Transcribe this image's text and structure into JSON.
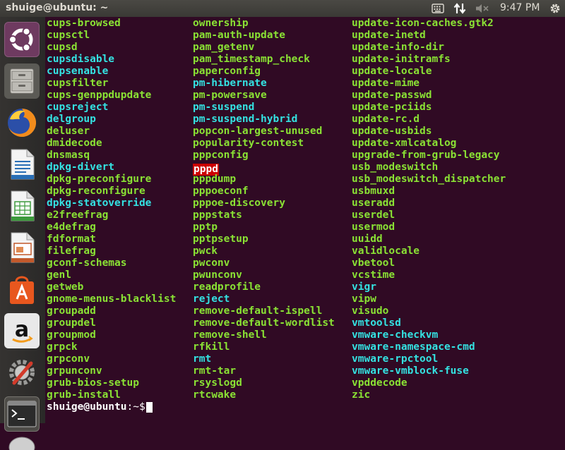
{
  "window": {
    "title": "shuige@ubuntu: ~"
  },
  "panel": {
    "clock": "9:47 PM",
    "icons": [
      "keyboard-icon",
      "network-transfer-icon",
      "volume-muted-icon",
      "power-gear-icon"
    ]
  },
  "launcher": {
    "items": [
      {
        "name": "ubuntu-dash-icon"
      },
      {
        "name": "files-icon"
      },
      {
        "name": "firefox-icon"
      },
      {
        "name": "libreoffice-writer-icon"
      },
      {
        "name": "libreoffice-calc-icon"
      },
      {
        "name": "libreoffice-impress-icon"
      },
      {
        "name": "ubuntu-software-icon"
      },
      {
        "name": "amazon-icon"
      },
      {
        "name": "system-settings-icon"
      },
      {
        "name": "terminal-icon"
      },
      {
        "name": "dvd-icon"
      }
    ]
  },
  "terminal": {
    "columns": [
      [
        {
          "t": "cups-browsed",
          "k": "exec"
        },
        {
          "t": "cupsctl",
          "k": "exec"
        },
        {
          "t": "cupsd",
          "k": "exec"
        },
        {
          "t": "cupsdisable",
          "k": "link"
        },
        {
          "t": "cupsenable",
          "k": "link"
        },
        {
          "t": "cupsfilter",
          "k": "exec"
        },
        {
          "t": "cups-genppdupdate",
          "k": "exec"
        },
        {
          "t": "cupsreject",
          "k": "link"
        },
        {
          "t": "delgroup",
          "k": "link"
        },
        {
          "t": "deluser",
          "k": "exec"
        },
        {
          "t": "dmidecode",
          "k": "exec"
        },
        {
          "t": "dnsmasq",
          "k": "exec"
        },
        {
          "t": "dpkg-divert",
          "k": "link"
        },
        {
          "t": "dpkg-preconfigure",
          "k": "exec"
        },
        {
          "t": "dpkg-reconfigure",
          "k": "exec"
        },
        {
          "t": "dpkg-statoverride",
          "k": "link"
        },
        {
          "t": "e2freefrag",
          "k": "exec"
        },
        {
          "t": "e4defrag",
          "k": "exec"
        },
        {
          "t": "fdformat",
          "k": "exec"
        },
        {
          "t": "filefrag",
          "k": "exec"
        },
        {
          "t": "gconf-schemas",
          "k": "exec"
        },
        {
          "t": "genl",
          "k": "exec"
        },
        {
          "t": "getweb",
          "k": "exec"
        },
        {
          "t": "gnome-menus-blacklist",
          "k": "exec"
        },
        {
          "t": "groupadd",
          "k": "exec"
        },
        {
          "t": "groupdel",
          "k": "exec"
        },
        {
          "t": "groupmod",
          "k": "exec"
        },
        {
          "t": "grpck",
          "k": "exec"
        },
        {
          "t": "grpconv",
          "k": "exec"
        },
        {
          "t": "grpunconv",
          "k": "exec"
        },
        {
          "t": "grub-bios-setup",
          "k": "exec"
        },
        {
          "t": "grub-install",
          "k": "exec"
        }
      ],
      [
        {
          "t": "ownership",
          "k": "exec"
        },
        {
          "t": "pam-auth-update",
          "k": "exec"
        },
        {
          "t": "pam_getenv",
          "k": "exec"
        },
        {
          "t": "pam_timestamp_check",
          "k": "exec"
        },
        {
          "t": "paperconfig",
          "k": "exec"
        },
        {
          "t": "pm-hibernate",
          "k": "link"
        },
        {
          "t": "pm-powersave",
          "k": "exec"
        },
        {
          "t": "pm-suspend",
          "k": "link"
        },
        {
          "t": "pm-suspend-hybrid",
          "k": "link"
        },
        {
          "t": "popcon-largest-unused",
          "k": "exec"
        },
        {
          "t": "popularity-contest",
          "k": "exec"
        },
        {
          "t": "pppconfig",
          "k": "exec"
        },
        {
          "t": "pppd",
          "k": "hl"
        },
        {
          "t": "pppdump",
          "k": "exec"
        },
        {
          "t": "pppoeconf",
          "k": "exec"
        },
        {
          "t": "pppoe-discovery",
          "k": "exec"
        },
        {
          "t": "pppstats",
          "k": "exec"
        },
        {
          "t": "pptp",
          "k": "exec"
        },
        {
          "t": "pptpsetup",
          "k": "exec"
        },
        {
          "t": "pwck",
          "k": "exec"
        },
        {
          "t": "pwconv",
          "k": "exec"
        },
        {
          "t": "pwunconv",
          "k": "exec"
        },
        {
          "t": "readprofile",
          "k": "exec"
        },
        {
          "t": "reject",
          "k": "link"
        },
        {
          "t": "remove-default-ispell",
          "k": "exec"
        },
        {
          "t": "remove-default-wordlist",
          "k": "exec"
        },
        {
          "t": "remove-shell",
          "k": "exec"
        },
        {
          "t": "rfkill",
          "k": "exec"
        },
        {
          "t": "rmt",
          "k": "link"
        },
        {
          "t": "rmt-tar",
          "k": "exec"
        },
        {
          "t": "rsyslogd",
          "k": "exec"
        },
        {
          "t": "rtcwake",
          "k": "exec"
        }
      ],
      [
        {
          "t": "update-icon-caches.gtk2",
          "k": "exec"
        },
        {
          "t": "update-inetd",
          "k": "exec"
        },
        {
          "t": "update-info-dir",
          "k": "exec"
        },
        {
          "t": "update-initramfs",
          "k": "exec"
        },
        {
          "t": "update-locale",
          "k": "exec"
        },
        {
          "t": "update-mime",
          "k": "exec"
        },
        {
          "t": "update-passwd",
          "k": "exec"
        },
        {
          "t": "update-pciids",
          "k": "exec"
        },
        {
          "t": "update-rc.d",
          "k": "exec"
        },
        {
          "t": "update-usbids",
          "k": "exec"
        },
        {
          "t": "update-xmlcatalog",
          "k": "exec"
        },
        {
          "t": "upgrade-from-grub-legacy",
          "k": "exec"
        },
        {
          "t": "usb_modeswitch",
          "k": "exec"
        },
        {
          "t": "usb_modeswitch_dispatcher",
          "k": "exec"
        },
        {
          "t": "usbmuxd",
          "k": "exec"
        },
        {
          "t": "useradd",
          "k": "exec"
        },
        {
          "t": "userdel",
          "k": "exec"
        },
        {
          "t": "usermod",
          "k": "exec"
        },
        {
          "t": "uuidd",
          "k": "exec"
        },
        {
          "t": "validlocale",
          "k": "exec"
        },
        {
          "t": "vbetool",
          "k": "exec"
        },
        {
          "t": "vcstime",
          "k": "exec"
        },
        {
          "t": "vigr",
          "k": "link"
        },
        {
          "t": "vipw",
          "k": "exec"
        },
        {
          "t": "visudo",
          "k": "exec"
        },
        {
          "t": "vmtoolsd",
          "k": "link"
        },
        {
          "t": "vmware-checkvm",
          "k": "link"
        },
        {
          "t": "vmware-namespace-cmd",
          "k": "link"
        },
        {
          "t": "vmware-rpctool",
          "k": "link"
        },
        {
          "t": "vmware-vmblock-fuse",
          "k": "link"
        },
        {
          "t": "vpddecode",
          "k": "exec"
        },
        {
          "t": "zic",
          "k": "exec"
        }
      ]
    ],
    "prompt": {
      "user_host": "shuige@ubuntu",
      "path": ":~$"
    }
  },
  "colors": {
    "terminal_bg": "#300a24",
    "exec_green": "#8ae234",
    "link_cyan": "#34e2e2",
    "highlight_red": "#cc0000"
  }
}
